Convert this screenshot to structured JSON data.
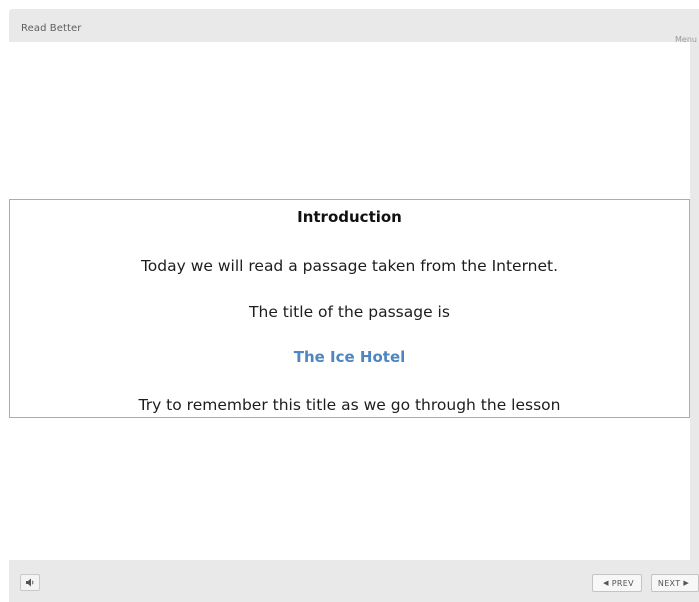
{
  "app": {
    "title": "Read Better",
    "menu_label": "Menu"
  },
  "slide": {
    "heading": "Introduction",
    "line1": "Today we will read a passage taken from the Internet.",
    "line2": "The title of the passage is",
    "passage_title": "The Ice Hotel",
    "line3": "Try to remember this title as we go through the lesson"
  },
  "footer": {
    "prev_label": "PREV",
    "next_label": "NEXT",
    "audio_icon": "speaker-icon",
    "prev_icon": "chevron-left-icon",
    "next_icon": "chevron-right-icon"
  },
  "colors": {
    "accent_border": "#e8a23e",
    "passage_title": "#4f86bf",
    "chrome": "#e9e9e9"
  }
}
